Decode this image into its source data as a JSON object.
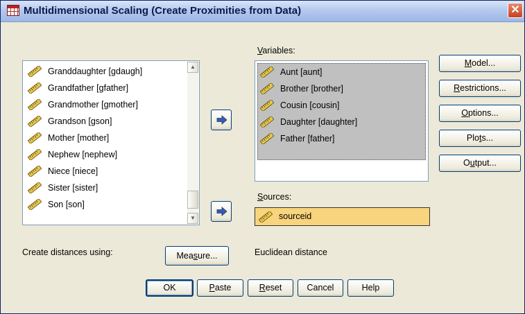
{
  "window": {
    "title": "Multidimensional Scaling (Create Proximities from Data)",
    "close_glyph": "✕"
  },
  "source_list": {
    "items": [
      {
        "label": "Granddaughter [gdaugh]"
      },
      {
        "label": "Grandfather [gfather]"
      },
      {
        "label": "Grandmother [gmother]"
      },
      {
        "label": "Grandson [gson]"
      },
      {
        "label": "Mother [mother]"
      },
      {
        "label": "Nephew [nephew]"
      },
      {
        "label": "Niece [niece]"
      },
      {
        "label": "Sister [sister]"
      },
      {
        "label": "Son [son]"
      }
    ]
  },
  "variables": {
    "label_pre": "",
    "label_ul": "V",
    "label_post": "ariables:",
    "items": [
      {
        "label": "Aunt [aunt]"
      },
      {
        "label": "Brother [brother]"
      },
      {
        "label": "Cousin [cousin]"
      },
      {
        "label": "Daughter [daughter]"
      },
      {
        "label": "Father [father]"
      }
    ]
  },
  "sources": {
    "label_pre": "",
    "label_ul": "S",
    "label_post": "ources:",
    "value": "sourceid"
  },
  "side_buttons": {
    "model": {
      "pre": "",
      "ul": "M",
      "post": "odel..."
    },
    "restrictions": {
      "pre": "",
      "ul": "R",
      "post": "estrictions..."
    },
    "options": {
      "pre": "",
      "ul": "O",
      "post": "ptions..."
    },
    "plots": {
      "pre": "Plo",
      "ul": "t",
      "post": "s..."
    },
    "output": {
      "pre": "O",
      "ul": "u",
      "post": "tput..."
    }
  },
  "distance": {
    "label": "Create distances using:",
    "button": {
      "pre": "Mea",
      "ul": "s",
      "post": "ure..."
    },
    "value": "Euclidean distance"
  },
  "footer": {
    "ok": "OK",
    "paste": {
      "pre": "",
      "ul": "P",
      "post": "aste"
    },
    "reset": {
      "pre": "",
      "ul": "R",
      "post": "eset"
    },
    "cancel": "Cancel",
    "help": "Help"
  },
  "colors": {
    "selected_bg": "#c0c0c0",
    "source_field_bg": "#f7d47d",
    "arrow_blue": "#3a5ba8"
  }
}
